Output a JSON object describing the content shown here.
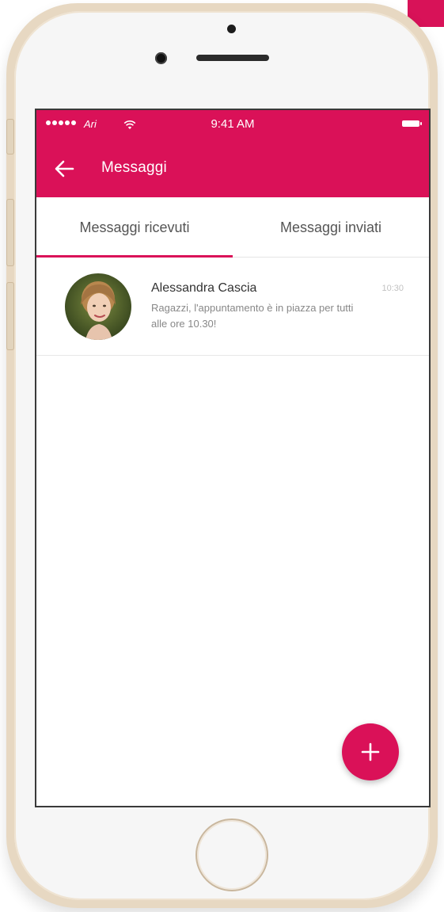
{
  "status_bar": {
    "carrier": "Ari",
    "time": "9:41 AM",
    "icons": [
      "signal-dots",
      "wifi-icon",
      "battery-icon"
    ]
  },
  "app_bar": {
    "title": "Messaggi",
    "back_icon": "arrow-left-icon"
  },
  "tabs": [
    {
      "label": "Messaggi ricevuti",
      "active": true
    },
    {
      "label": "Messaggi inviati",
      "active": false
    }
  ],
  "messages": [
    {
      "sender": "Alessandra Cascia",
      "preview": "Ragazzi, l'appuntamento è in piazza per tutti alle ore 10.30!",
      "time": "10:30"
    }
  ],
  "fab": {
    "icon": "plus-icon"
  },
  "colors": {
    "accent": "#da1158",
    "text_primary": "#333333",
    "text_secondary": "#888888",
    "divider": "#e5e5e5"
  }
}
